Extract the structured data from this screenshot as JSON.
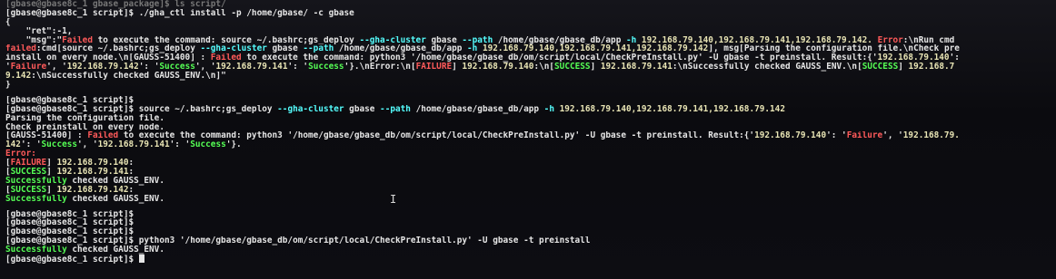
{
  "terminal": {
    "lines": [
      {
        "segs": [
          [
            "[gbase@gbase8c_1 gbase_package]$ ls script/",
            "dim"
          ]
        ]
      },
      {
        "segs": [
          [
            "[gbase@gbase8c_1 script]$ ./gha_ctl install -p /home/gbase/ -c gbase",
            "w"
          ]
        ]
      },
      {
        "segs": [
          [
            "{",
            "w"
          ]
        ]
      },
      {
        "segs": [
          [
            "    \"ret\":-1,",
            "w"
          ]
        ]
      },
      {
        "segs": [
          [
            "    \"msg\":\"",
            "w"
          ],
          [
            "Failed",
            "r"
          ],
          [
            " to execute the command: source ~/.bashrc;gs_deploy ",
            "w"
          ],
          [
            "--gha-cluster",
            "c"
          ],
          [
            " gbase ",
            "w"
          ],
          [
            "--path",
            "c"
          ],
          [
            " /home/gbase/gbase_db/app ",
            "w"
          ],
          [
            "-h",
            "c"
          ],
          [
            " 192.168.79.140,192.168.79.141,192.168.79.142. ",
            "y"
          ],
          [
            "Error",
            "r"
          ],
          [
            ":\\nRun cmd",
            "w"
          ]
        ]
      },
      {
        "segs": [
          [
            "failed",
            "r"
          ],
          [
            ":cmd[source ~/.bashrc;gs_deploy ",
            "w"
          ],
          [
            "--gha-cluster",
            "c"
          ],
          [
            " gbase ",
            "w"
          ],
          [
            "--path",
            "c"
          ],
          [
            " /home/gbase/gbase_db/app ",
            "w"
          ],
          [
            "-h",
            "c"
          ],
          [
            " 192.168.79.140,192.168.79.141,192.168.79.142",
            "y"
          ],
          [
            "], msg[Parsing the configuration file.\\nCheck pre",
            "w"
          ]
        ]
      },
      {
        "segs": [
          [
            "install on every node.\\n[GAUSS-51400] : ",
            "w"
          ],
          [
            "Failed",
            "r"
          ],
          [
            " to execute the command: python3 '/home/gbase/gbase_db/om/script/local/CheckPreInstall.py' -U gbase -t preinstall. Result:{'",
            "w"
          ],
          [
            "192.168.79.140",
            "y"
          ],
          [
            "':",
            "w"
          ]
        ]
      },
      {
        "segs": [
          [
            "'",
            "w"
          ],
          [
            "Failure",
            "r"
          ],
          [
            "', '",
            "w"
          ],
          [
            "192.168.79.142",
            "y"
          ],
          [
            "': '",
            "w"
          ],
          [
            "Success",
            "g"
          ],
          [
            "', '",
            "w"
          ],
          [
            "192.168.79.141",
            "y"
          ],
          [
            "': '",
            "w"
          ],
          [
            "Success",
            "g"
          ],
          [
            "'}.\\nError:\\n[",
            "w"
          ],
          [
            "FAILURE",
            "r"
          ],
          [
            "] ",
            "w"
          ],
          [
            "192.168.79.140",
            "y"
          ],
          [
            ":\\n[",
            "w"
          ],
          [
            "SUCCESS",
            "g"
          ],
          [
            "] ",
            "w"
          ],
          [
            "192.168.79.141",
            "y"
          ],
          [
            ":\\nSuccessfully checked GAUSS_ENV.\\n[",
            "w"
          ],
          [
            "SUCCESS",
            "g"
          ],
          [
            "] ",
            "w"
          ],
          [
            "192.168.7",
            "y"
          ]
        ]
      },
      {
        "segs": [
          [
            "9.142",
            "y"
          ],
          [
            ":\\nSuccessfully checked GAUSS_ENV.\\n]\"",
            "w"
          ]
        ]
      },
      {
        "segs": [
          [
            "}",
            "w"
          ]
        ]
      },
      {
        "segs": [
          [
            "[gbase@gbase8c_1 script]$",
            "w"
          ]
        ],
        "gap": true
      },
      {
        "segs": [
          [
            "[gbase@gbase8c_1 script]$ source ~/.bashrc;gs_deploy ",
            "w"
          ],
          [
            "--gha-cluster",
            "c"
          ],
          [
            " gbase ",
            "w"
          ],
          [
            "--path",
            "c"
          ],
          [
            " /home/gbase/gbase_db/app ",
            "w"
          ],
          [
            "-h",
            "c"
          ],
          [
            " 192.168.79.140,192.168.79.141,192.168.79.142",
            "y"
          ]
        ]
      },
      {
        "segs": [
          [
            "Parsing the configuration file.",
            "w"
          ]
        ]
      },
      {
        "segs": [
          [
            "Check preinstall on every node.",
            "w"
          ]
        ]
      },
      {
        "segs": [
          [
            "[GAUSS-51400] : ",
            "w"
          ],
          [
            "Failed",
            "r"
          ],
          [
            " to execute the command: python3 '/home/gbase/gbase_db/om/script/local/CheckPreInstall.py' -U gbase -t preinstall. Result:{'",
            "w"
          ],
          [
            "192.168.79.140",
            "y"
          ],
          [
            "': '",
            "w"
          ],
          [
            "Failure",
            "r"
          ],
          [
            "', '",
            "w"
          ],
          [
            "192.168.79.",
            "y"
          ]
        ]
      },
      {
        "segs": [
          [
            "142",
            "y"
          ],
          [
            "': '",
            "w"
          ],
          [
            "Success",
            "g"
          ],
          [
            "', '",
            "w"
          ],
          [
            "192.168.79.141",
            "y"
          ],
          [
            "': '",
            "w"
          ],
          [
            "Success",
            "g"
          ],
          [
            "'}.",
            "w"
          ]
        ]
      },
      {
        "segs": [
          [
            "Error:",
            "r"
          ]
        ]
      },
      {
        "segs": [
          [
            "[",
            "w"
          ],
          [
            "FAILURE",
            "r"
          ],
          [
            "] ",
            "w"
          ],
          [
            "192.168.79.140",
            "y"
          ],
          [
            ":",
            "w"
          ]
        ]
      },
      {
        "segs": [
          [
            "[",
            "w"
          ],
          [
            "SUCCESS",
            "g"
          ],
          [
            "] ",
            "w"
          ],
          [
            "192.168.79.141",
            "y"
          ],
          [
            ":",
            "w"
          ]
        ]
      },
      {
        "segs": [
          [
            "Successfully",
            "g"
          ],
          [
            " checked GAUSS_ENV.",
            "w"
          ]
        ]
      },
      {
        "segs": [
          [
            "[",
            "w"
          ],
          [
            "SUCCESS",
            "g"
          ],
          [
            "] ",
            "w"
          ],
          [
            "192.168.79.142",
            "y"
          ],
          [
            ":",
            "w"
          ]
        ]
      },
      {
        "segs": [
          [
            "Successfully",
            "g"
          ],
          [
            " checked GAUSS_ENV.",
            "w"
          ]
        ]
      },
      {
        "segs": [
          [
            "[gbase@gbase8c_1 script]$",
            "w"
          ]
        ],
        "gap": true
      },
      {
        "segs": [
          [
            "[gbase@gbase8c_1 script]$",
            "w"
          ]
        ]
      },
      {
        "segs": [
          [
            "[gbase@gbase8c_1 script]$",
            "w"
          ]
        ]
      },
      {
        "segs": [
          [
            "[gbase@gbase8c_1 script]$ python3 '/home/gbase/gbase_db/om/script/local/CheckPreInstall.py' -U gbase -t preinstall",
            "w"
          ]
        ]
      },
      {
        "segs": [
          [
            "Successfully",
            "g"
          ],
          [
            " checked GAUSS_ENV.",
            "w"
          ]
        ]
      },
      {
        "segs": [
          [
            "[gbase@gbase8c_1 script]$ ",
            "w"
          ]
        ],
        "cursor": true
      }
    ]
  }
}
